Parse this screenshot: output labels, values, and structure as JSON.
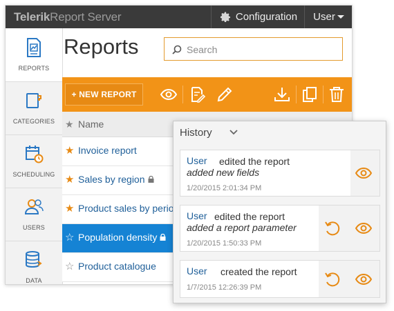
{
  "topbar": {
    "brand_prefix": "Telerik",
    "brand_suffix": "Report Server",
    "configuration_label": "Configuration",
    "user_label": "User"
  },
  "sidebar": {
    "items": [
      {
        "label": "REPORTS",
        "icon": "report-icon",
        "active": true
      },
      {
        "label": "CATEGORIES",
        "icon": "categories-icon",
        "active": false
      },
      {
        "label": "SCHEDULING",
        "icon": "calendar-clock-icon",
        "active": false
      },
      {
        "label": "USERS",
        "icon": "users-icon",
        "active": false
      },
      {
        "label": "DATA",
        "icon": "database-icon",
        "active": false
      }
    ]
  },
  "page": {
    "title": "Reports"
  },
  "search": {
    "placeholder": "Search"
  },
  "toolbar": {
    "new_report_label": "+ NEW REPORT",
    "icons": [
      "eye-icon",
      "edit-document-icon",
      "pencil-icon",
      "download-icon",
      "copy-icon",
      "trash-icon"
    ]
  },
  "table": {
    "header": {
      "name": "Name"
    },
    "rows": [
      {
        "name": "Invoice report",
        "favorite": true,
        "locked": false,
        "selected": false
      },
      {
        "name": "Sales by region",
        "favorite": true,
        "locked": true,
        "selected": false
      },
      {
        "name": "Product sales by perio",
        "favorite": true,
        "locked": false,
        "selected": false
      },
      {
        "name": "Population density",
        "favorite": false,
        "locked": true,
        "selected": true
      },
      {
        "name": "Product catalogue",
        "favorite": false,
        "locked": false,
        "selected": false
      }
    ]
  },
  "history": {
    "title": "History",
    "entries": [
      {
        "user": "User",
        "action": "edited the report",
        "detail": "added new fields",
        "timestamp": "1/20/2015 2:01:34 PM",
        "revert": false
      },
      {
        "user": "User",
        "action": "edited the report",
        "detail": "added a report parameter",
        "timestamp": "1/20/2015 1:50:33 PM",
        "revert": true
      },
      {
        "user": "User",
        "action": "created the report",
        "detail": "",
        "timestamp": "1/7/2015 12:26:39 PM",
        "revert": true
      }
    ]
  },
  "colors": {
    "accent_orange": "#f29317",
    "selection_blue": "#1583d4",
    "link_blue": "#1f5f99",
    "topbar_dark": "#3a3a3a",
    "icon_blue": "#2a78c4"
  }
}
